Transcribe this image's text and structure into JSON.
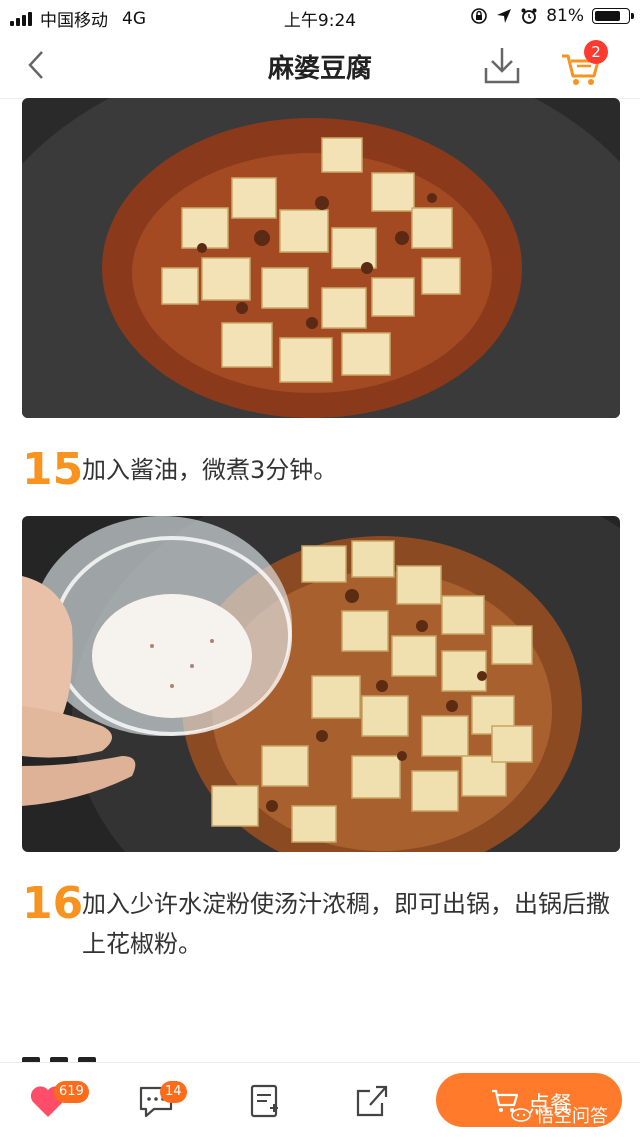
{
  "status_bar": {
    "carrier": "中国移动",
    "network": "4G",
    "time": "上午9:24",
    "battery_percent": "81%",
    "battery_level": 0.81
  },
  "nav": {
    "title": "麻婆豆腐",
    "cart_count": "2"
  },
  "steps": [
    {
      "number": "15",
      "text": "加入酱油，微煮3分钟。"
    },
    {
      "number": "16",
      "text": "加入少许水淀粉使汤汁浓稠，即可出锅，出锅后撒上花椒粉。"
    }
  ],
  "bottom_bar": {
    "likes": "619",
    "comments": "14",
    "order_label": "点餐"
  },
  "watermark": "悟空问答",
  "colors": {
    "accent": "#f7931e",
    "order_button": "#ff7a2a",
    "badge_red": "#ff3b30",
    "like_heart": "#ff4d6a"
  }
}
